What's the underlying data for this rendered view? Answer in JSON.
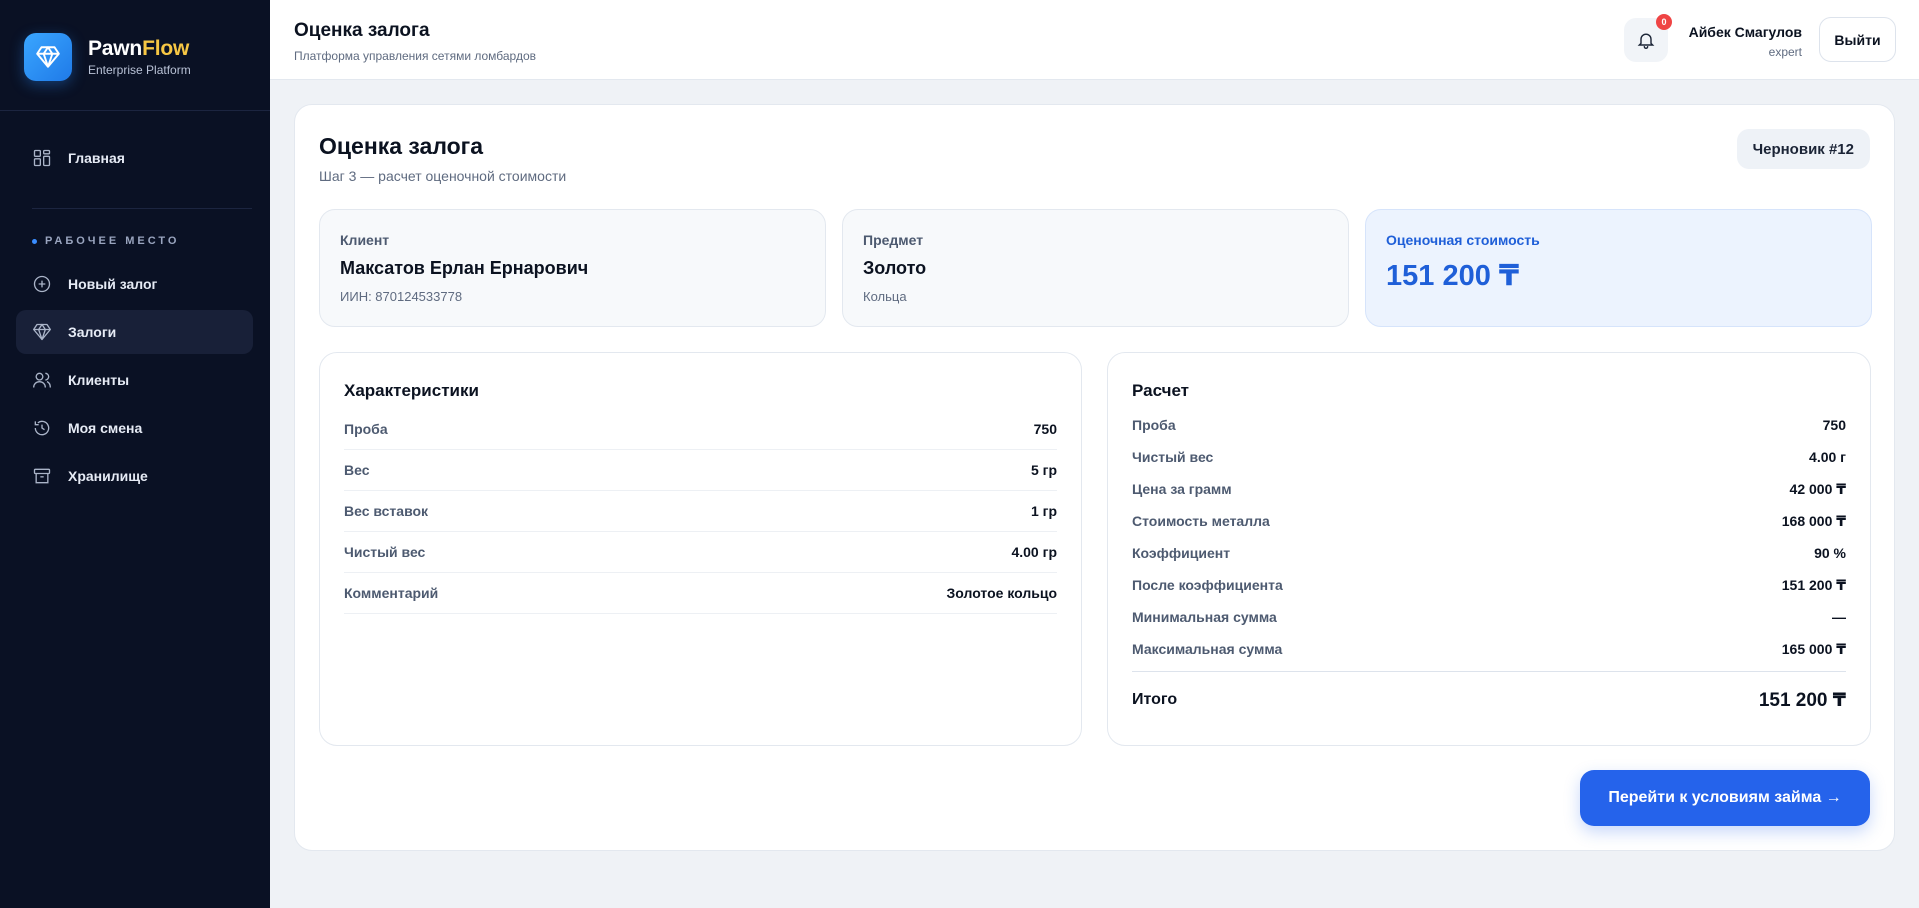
{
  "brand": {
    "name_main": "Pawn",
    "name_accent": "Flow",
    "subtitle": "Enterprise Platform",
    "logo_icon": "diamond-icon"
  },
  "sidebar": {
    "home": {
      "label": "Главная",
      "icon": "grid-icon"
    },
    "section_title": "РАБОЧЕЕ МЕСТО",
    "items": [
      {
        "label": "Новый залог",
        "icon": "plus-circle-icon"
      },
      {
        "label": "Залоги",
        "icon": "diamond-icon",
        "active": true
      },
      {
        "label": "Клиенты",
        "icon": "users-icon"
      },
      {
        "label": "Моя смена",
        "icon": "history-icon"
      },
      {
        "label": "Хранилище",
        "icon": "archive-icon"
      }
    ]
  },
  "header": {
    "title": "Оценка залога",
    "subtitle": "Платформа управления сетями ломбардов",
    "notifications_count": "0",
    "user_name": "Айбек Смагулов",
    "user_role": "expert",
    "logout_label": "Выйти"
  },
  "page": {
    "title": "Оценка залога",
    "subtitle": "Шаг 3 — расчет оценочной стоимости",
    "draft_badge": "Черновик #12"
  },
  "summary": {
    "client": {
      "label": "Клиент",
      "value": "Максатов Ерлан Ернарович",
      "sub": "ИИН: 870124533778"
    },
    "item": {
      "label": "Предмет",
      "value": "Золото",
      "sub": "Кольца"
    },
    "estimate": {
      "label": "Оценочная стоимость",
      "value": "151 200 ₸"
    }
  },
  "characteristics": {
    "title": "Характеристики",
    "rows": [
      {
        "k": "Проба",
        "v": "750"
      },
      {
        "k": "Вес",
        "v": "5 гр"
      },
      {
        "k": "Вес вставок",
        "v": "1 гр"
      },
      {
        "k": "Чистый вес",
        "v": "4.00 гр"
      },
      {
        "k": "Комментарий",
        "v": "Золотое кольцо"
      }
    ]
  },
  "calculation": {
    "title": "Расчет",
    "rows": [
      {
        "k": "Проба",
        "v": "750"
      },
      {
        "k": "Чистый вес",
        "v": "4.00 г"
      },
      {
        "k": "Цена за грамм",
        "v": "42 000 ₸"
      },
      {
        "k": "Стоимость металла",
        "v": "168 000 ₸"
      },
      {
        "k": "Коэффициент",
        "v": "90 %"
      },
      {
        "k": "После коэффициента",
        "v": "151 200 ₸"
      },
      {
        "k": "Минимальная сумма",
        "v": "—"
      },
      {
        "k": "Максимальная сумма",
        "v": "165 000 ₸"
      }
    ],
    "total_label": "Итого",
    "total_value": "151 200 ₸"
  },
  "actions": {
    "next_label": "Перейти к условиям займа →"
  },
  "colors": {
    "sidebar_bg": "#0a1124",
    "accent": "#2563eb",
    "brand_accent": "#f7c744",
    "badge": "#ef4444"
  }
}
